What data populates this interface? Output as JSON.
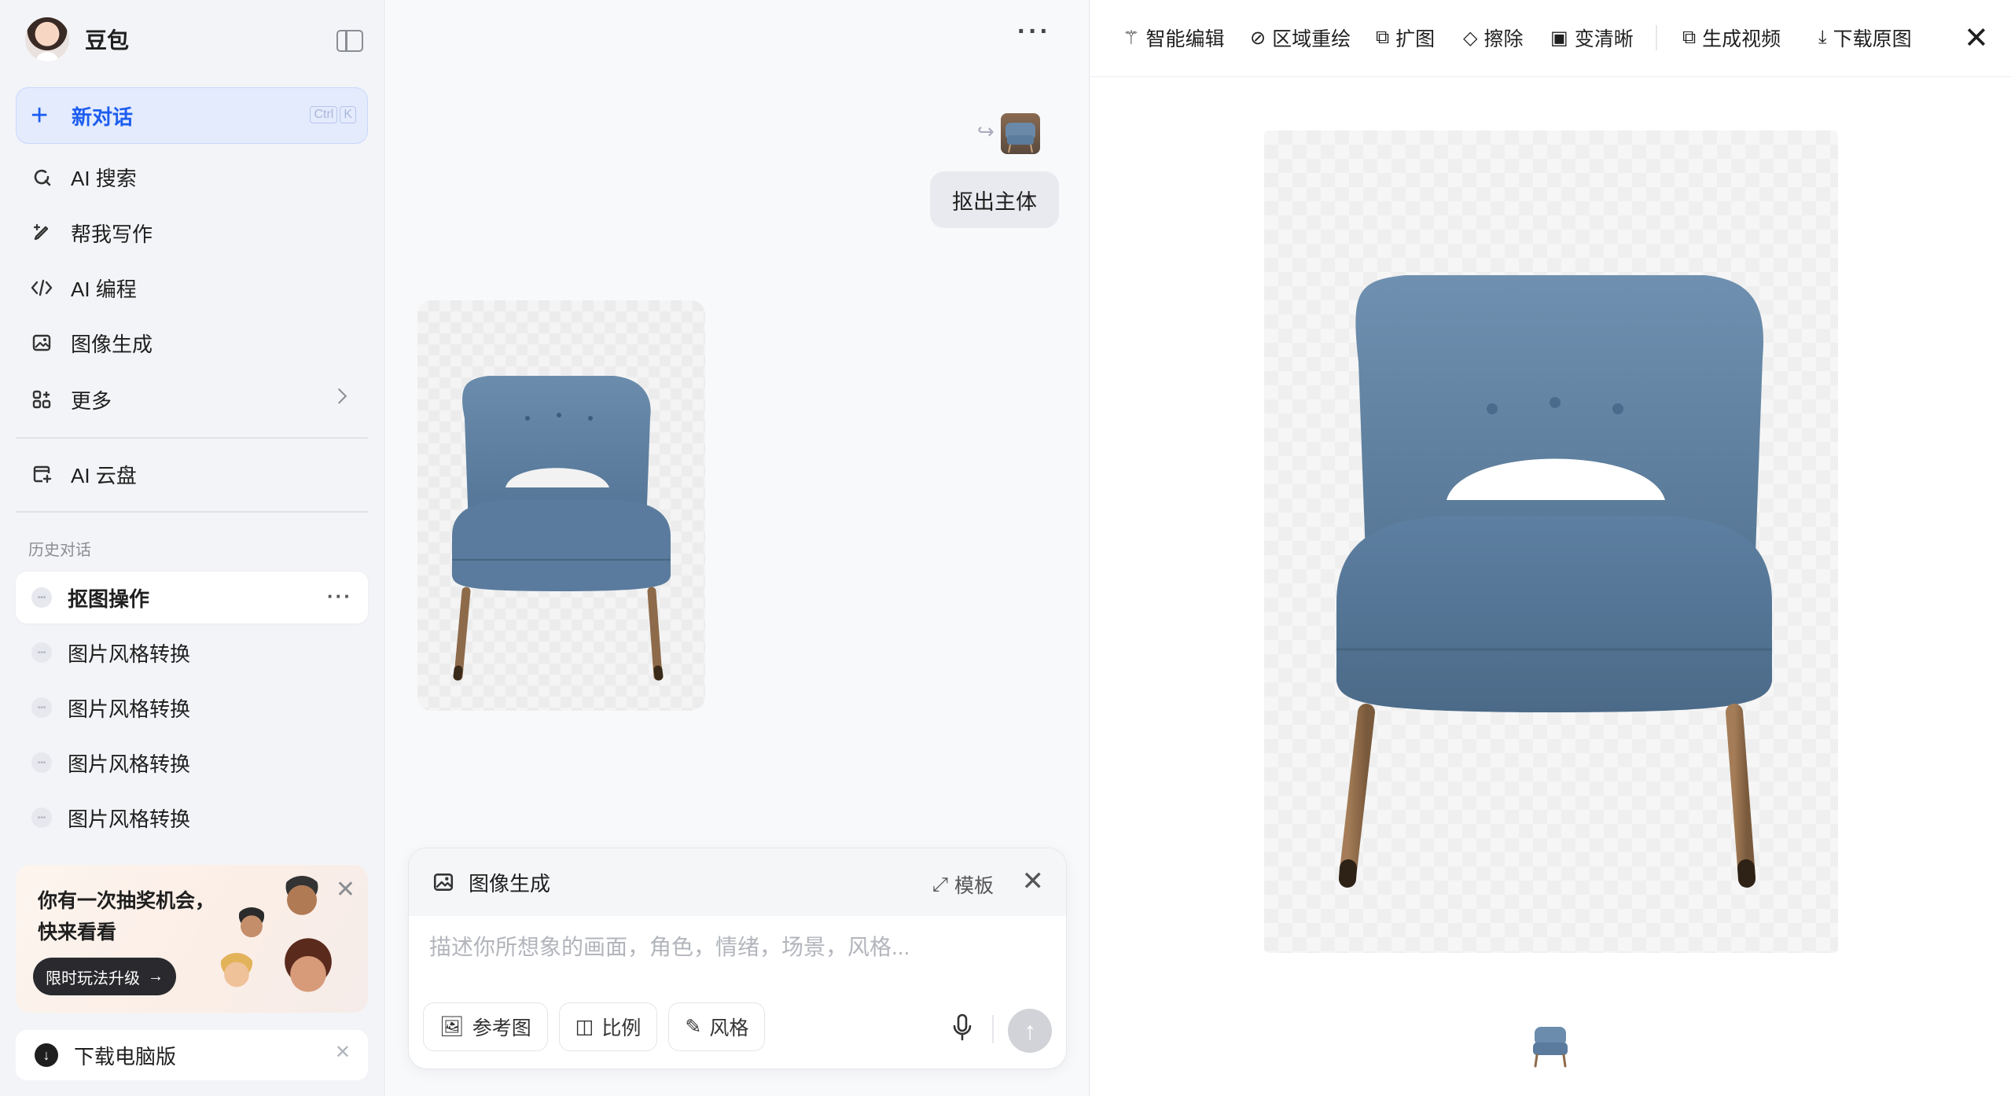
{
  "sidebar": {
    "brand": "豆包",
    "new_chat": {
      "label": "新对话",
      "shortcut": [
        "Ctrl",
        "K"
      ]
    },
    "nav": [
      {
        "label": "AI 搜索",
        "icon": "search-icon"
      },
      {
        "label": "帮我写作",
        "icon": "pen-icon"
      },
      {
        "label": "AI 编程",
        "icon": "code-icon"
      },
      {
        "label": "图像生成",
        "icon": "image-icon"
      },
      {
        "label": "更多",
        "icon": "apps-icon"
      }
    ],
    "cloud": {
      "label": "AI 云盘",
      "icon": "cloud-drive-icon"
    },
    "history_title": "历史对话",
    "history": [
      {
        "label": "抠图操作",
        "active": true
      },
      {
        "label": "图片风格转换"
      },
      {
        "label": "图片风格转换"
      },
      {
        "label": "图片风格转换"
      },
      {
        "label": "图片风格转换"
      }
    ],
    "promo": {
      "text": "你有一次抽奖机会，快来看看",
      "button": "限时玩法升级"
    },
    "download": {
      "label": "下载电脑版"
    }
  },
  "chat": {
    "user_message": "抠出主体",
    "composer": {
      "mode": "图像生成",
      "template": "模板",
      "placeholder": "描述你所想象的画面，角色，情绪，场景，风格...",
      "chips": [
        "参考图",
        "比例",
        "风格"
      ]
    }
  },
  "viewer": {
    "tools": [
      "智能编辑",
      "区域重绘",
      "扩图",
      "擦除",
      "变清晰",
      "生成视频",
      "下载原图"
    ]
  },
  "colors": {
    "accent": "#1d5df0",
    "chair": "#5b7c9c",
    "legs": "#8d6a4a"
  }
}
